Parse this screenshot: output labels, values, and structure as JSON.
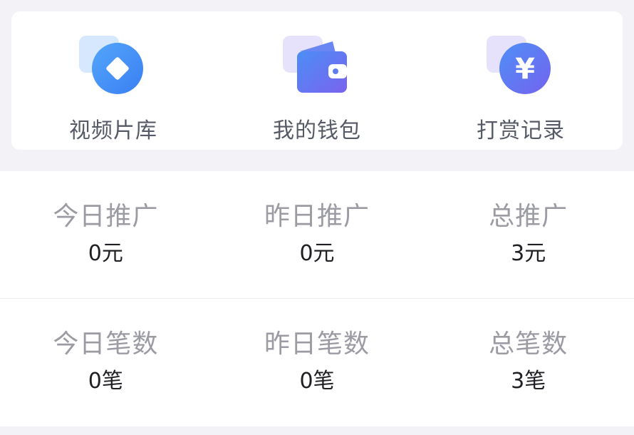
{
  "shortcuts": [
    {
      "label": "视频片库",
      "icon": "video-library-icon"
    },
    {
      "label": "我的钱包",
      "icon": "wallet-icon"
    },
    {
      "label": "打赏记录",
      "icon": "reward-yuan-icon",
      "glyph": "¥"
    }
  ],
  "stats": {
    "row1": [
      {
        "label": "今日推广",
        "value": "0元"
      },
      {
        "label": "昨日推广",
        "value": "0元"
      },
      {
        "label": "总推广",
        "value": "3元"
      }
    ],
    "row2": [
      {
        "label": "今日笔数",
        "value": "0笔"
      },
      {
        "label": "昨日笔数",
        "value": "0笔"
      },
      {
        "label": "总笔数",
        "value": "3笔"
      }
    ]
  },
  "colors": {
    "accent_blue": "#3f8cf7",
    "accent_purple": "#7a63ee",
    "icon_tint_blue": "#d6e8fd",
    "icon_tint_purple": "#e6e2fb",
    "background": "#f3f3f7"
  }
}
